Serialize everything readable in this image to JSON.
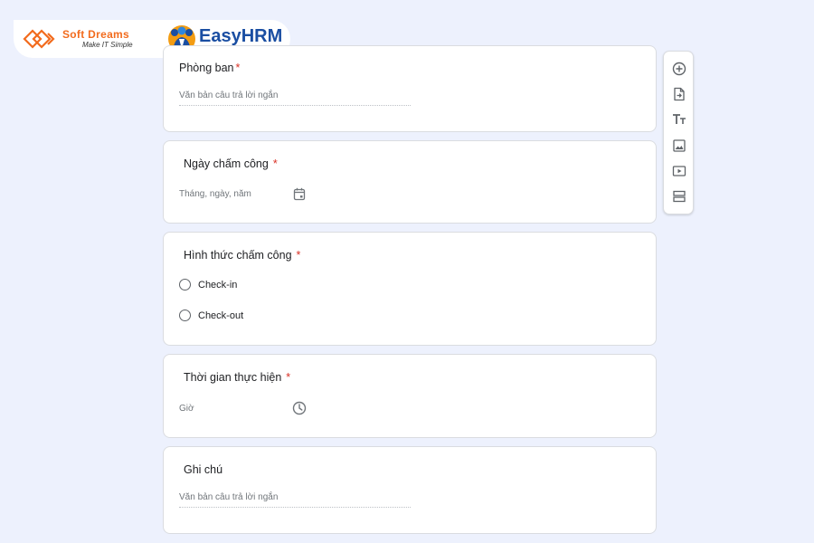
{
  "brand": {
    "softdreams_name": "Soft Dreams",
    "softdreams_tagline": "Make IT Simple",
    "easyhrm_name": "EasyHRM"
  },
  "colors": {
    "background": "#edf1fd",
    "required_star": "#d93025",
    "softdreams_orange": "#f26b1d",
    "easyhrm_blue": "#1a4ea2"
  },
  "questions": [
    {
      "title": "Phòng ban",
      "required_mark": "*",
      "placeholder": "Văn bản câu trả lời ngắn"
    },
    {
      "title": "Ngày chấm công",
      "required_mark": "*",
      "placeholder": "Tháng, ngày, năm",
      "icon": "calendar-icon"
    },
    {
      "title": "Hình thức chấm công",
      "required_mark": "*",
      "options": [
        "Check-in",
        "Check-out"
      ]
    },
    {
      "title": "Thời gian thực hiện",
      "required_mark": "*",
      "placeholder": "Giờ",
      "icon": "clock-icon"
    },
    {
      "title": "Ghi chú",
      "placeholder": "Văn bản câu trả lời ngắn"
    }
  ],
  "toolbar": [
    "add-question-icon",
    "import-questions-icon",
    "add-title-icon",
    "add-image-icon",
    "add-video-icon",
    "add-section-icon"
  ]
}
